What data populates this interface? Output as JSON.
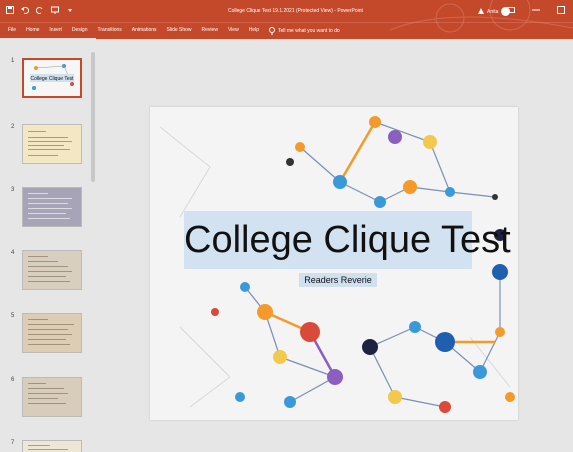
{
  "window": {
    "doc_title": "College Clique Test 19.1.2021 (Protected View) - PowerPoint",
    "user_name": "Anita",
    "accent": "#c4492b"
  },
  "ribbon": {
    "tabs": [
      "File",
      "Home",
      "Insert",
      "Design",
      "Transitions",
      "Animations",
      "Slide Show",
      "Review",
      "View",
      "Help"
    ],
    "tell_me": "Tell me what you want to do"
  },
  "thumbnails": {
    "numbers": [
      "1",
      "2",
      "3",
      "4",
      "5",
      "6",
      "7"
    ],
    "first_title": "College Clique Test"
  },
  "slide": {
    "title": "College Clique Test",
    "subtitle": "Readers Reverie"
  }
}
